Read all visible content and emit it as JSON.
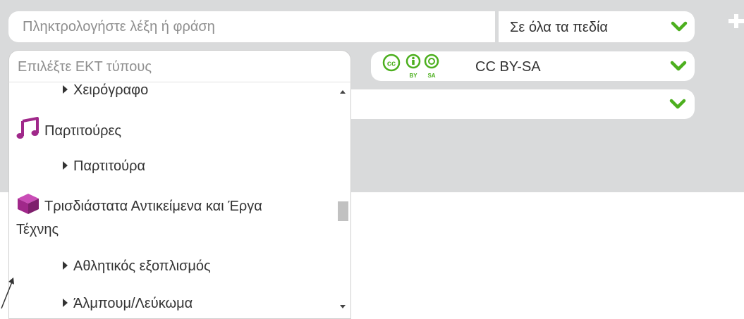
{
  "search": {
    "placeholder": "Πληκτρολογήστε λέξη ή φράση"
  },
  "scope_select": {
    "selected": "Σε όλα τα πεδία"
  },
  "type_select": {
    "placeholder": "Επιλέξτε ΕΚΤ τύπους"
  },
  "license_select": {
    "selected": "CC BY-SA",
    "badge_icons": [
      "cc-icon",
      "by-icon",
      "sa-icon"
    ]
  },
  "dropdown": {
    "options": [
      {
        "label": "Χειρόγραφο",
        "level": "sub"
      },
      {
        "label": "Παρτιτούρες",
        "level": "category",
        "icon": "music-note-icon"
      },
      {
        "label": "Παρτιτούρα",
        "level": "sub"
      },
      {
        "label": "Τρισδιάστατα Αντικείμενα και Έργα",
        "label_line2": "Τέχνης",
        "level": "category",
        "icon": "cube-icon"
      },
      {
        "label": "Αθλητικός εξοπλισμός",
        "level": "sub"
      },
      {
        "label": "Άλμπουμ/Λεύκωμα",
        "level": "sub"
      }
    ]
  },
  "colors": {
    "panel_bg": "#d9dadb",
    "chevron": "#4caf1e",
    "category_icon": "#a0288a",
    "cc_badge": "#4caf1e"
  }
}
